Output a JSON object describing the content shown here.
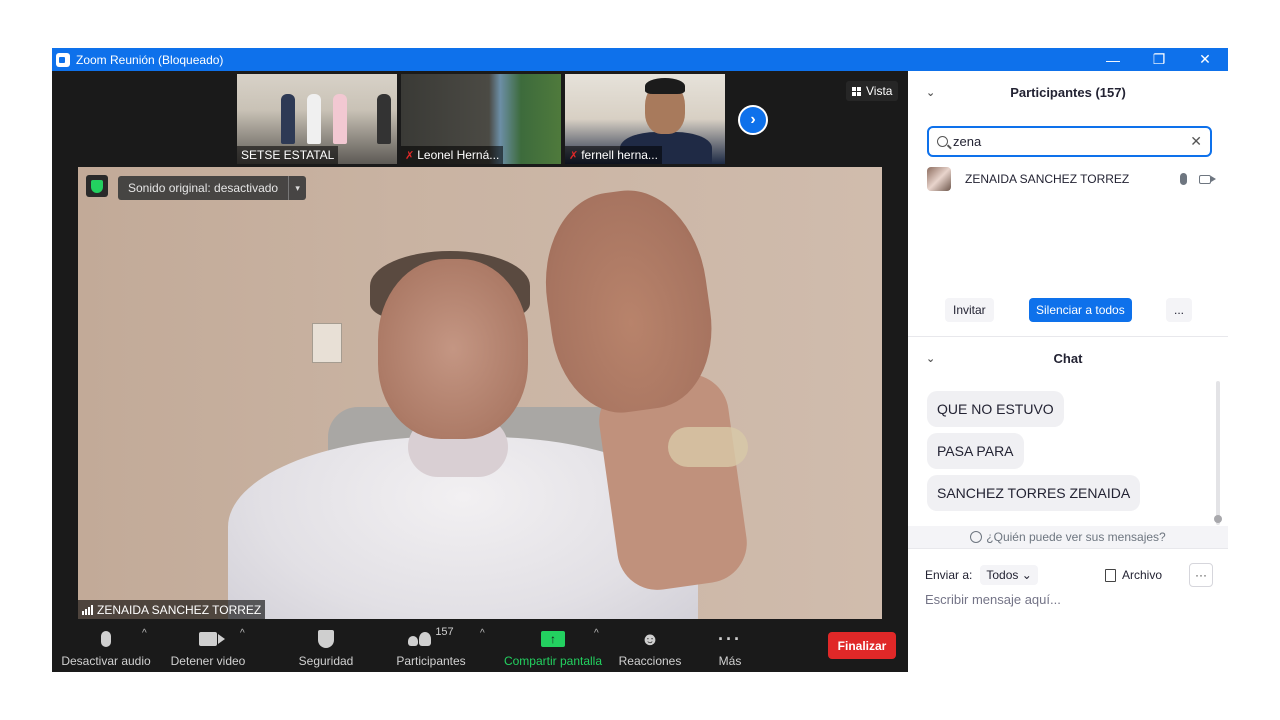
{
  "window": {
    "title": "Zoom Reunión (Bloqueado)",
    "minimize": "—",
    "restore": "❐",
    "close": "✕"
  },
  "thumbnails": [
    {
      "name": "SETSE ESTATAL",
      "muted": false
    },
    {
      "name": "Leonel Herná...",
      "muted": true
    },
    {
      "name": "fernell herna...",
      "muted": true
    }
  ],
  "next_arrow": "›",
  "view_button": {
    "label": "Vista"
  },
  "main_video": {
    "sound_label": "Sonido original: desactivado",
    "dropdown_glyph": "▾",
    "speaker_name": "ZENAIDA SANCHEZ TORREZ"
  },
  "toolbar": {
    "audio_label": "Desactivar audio",
    "video_label": "Detener video",
    "security_label": "Seguridad",
    "participants_label": "Participantes",
    "participants_count": "157",
    "share_label": "Compartir pantalla",
    "reactions_label": "Reacciones",
    "more_label": "Más",
    "end_label": "Finalizar",
    "caret": "^"
  },
  "participants_panel": {
    "title": "Participantes (157)",
    "search_value": "zena",
    "participants": [
      {
        "name": "ZENAIDA SANCHEZ TORREZ"
      }
    ],
    "invite_label": "Invitar",
    "mute_all_label": "Silenciar a todos",
    "more_label": "..."
  },
  "chat_panel": {
    "title": "Chat",
    "messages": [
      {
        "text": "QUE NO ESTUVO"
      },
      {
        "text": "PASA PARA"
      },
      {
        "text": "SANCHEZ TORRES ZENAIDA"
      }
    ],
    "who_can_see": "¿Quién puede ver sus mensajes?",
    "send_to_label": "Enviar a:",
    "send_to_value": "Todos",
    "file_label": "Archivo",
    "more_label": "···",
    "compose_placeholder": "Escribir mensaje aquí..."
  },
  "colors": {
    "zoom_blue": "#0e71eb",
    "end_red": "#e02828",
    "share_green": "#23d160",
    "toolbar_bg": "#1a1a1a"
  }
}
